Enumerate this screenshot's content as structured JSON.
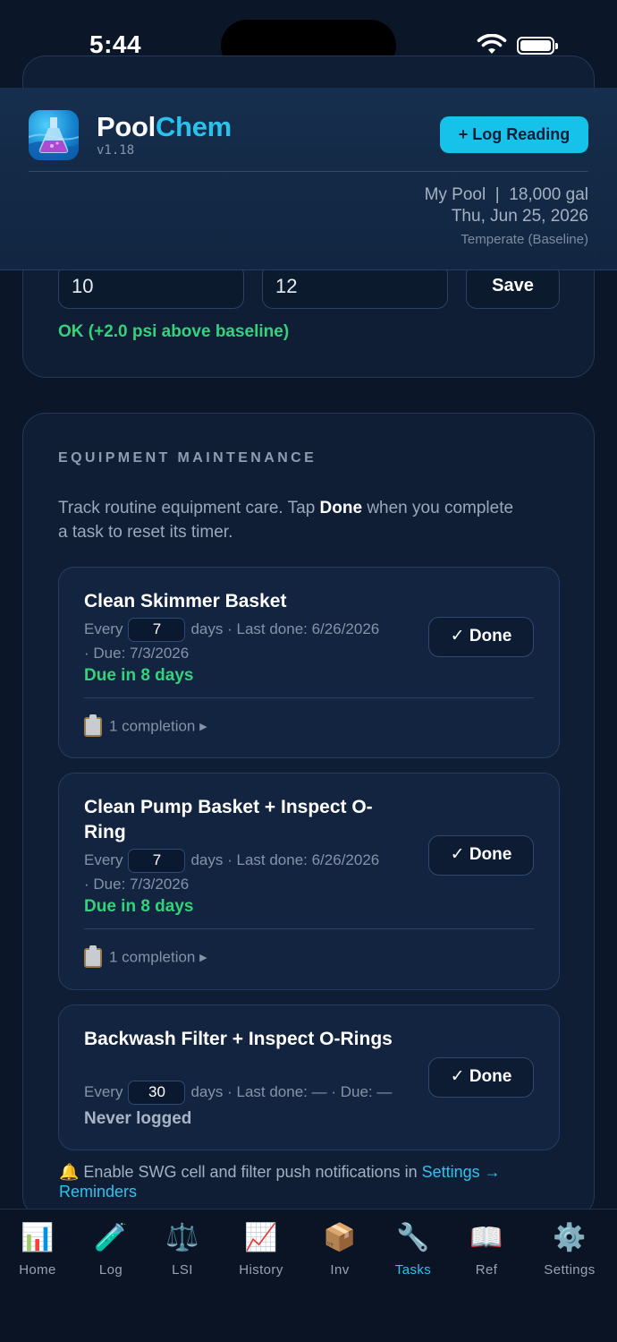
{
  "status_bar": {
    "time": "5:44"
  },
  "pressure": {
    "baseline_value": "10",
    "current_value": "12",
    "save_label": "Save",
    "status": "OK (+2.0 psi above baseline)"
  },
  "header": {
    "title_part1": "Pool",
    "title_part2": "Chem",
    "version": "v1.18",
    "log_button": "+ Log Reading",
    "pool_info": "My Pool  |  18,000 gal",
    "date": "Thu, Jun 25, 2026",
    "climate": "Temperate (Baseline)"
  },
  "maintenance": {
    "title": "EQUIPMENT MAINTENANCE",
    "desc_before": "Track routine equipment care. Tap ",
    "desc_bold": "Done",
    "desc_after": " when you complete a task to reset its timer.",
    "tasks": [
      {
        "name": "Clean Skimmer Basket",
        "every_label": "Every",
        "interval": "7",
        "schedule": "days · Last done: 6/26/2026",
        "due_date": "· Due: 7/3/2026",
        "due_status": "Due in 8 days",
        "done_label": "✓ Done",
        "completions": "1 completion ▸"
      },
      {
        "name": "Clean Pump Basket + Inspect O-Ring",
        "every_label": "Every",
        "interval": "7",
        "schedule": "days · Last done: 6/26/2026",
        "due_date": "· Due: 7/3/2026",
        "due_status": "Due in 8 days",
        "done_label": "✓ Done",
        "completions": "1 completion ▸"
      },
      {
        "name": "Backwash Filter + Inspect O-Rings",
        "every_label": "Every",
        "interval": "30",
        "schedule": "days · Last done: — · Due: —",
        "due_status": "Never logged",
        "done_label": "✓ Done"
      }
    ],
    "notice_text": "🔔 Enable SWG cell and filter push notifications in ",
    "notice_link": "Settings → Reminders"
  },
  "tabs": [
    {
      "label": "Home",
      "icon": "📊"
    },
    {
      "label": "Log",
      "icon": "🧪"
    },
    {
      "label": "LSI",
      "icon": "⚖️"
    },
    {
      "label": "History",
      "icon": "📈"
    },
    {
      "label": "Inv",
      "icon": "📦"
    },
    {
      "label": "Tasks",
      "icon": "🔧",
      "active": true
    },
    {
      "label": "Ref",
      "icon": "📖"
    },
    {
      "label": "Settings",
      "icon": "⚙️"
    }
  ],
  "colors": {
    "accent": "#18c6ee",
    "ok": "#34d27a",
    "background": "#0b1628"
  }
}
